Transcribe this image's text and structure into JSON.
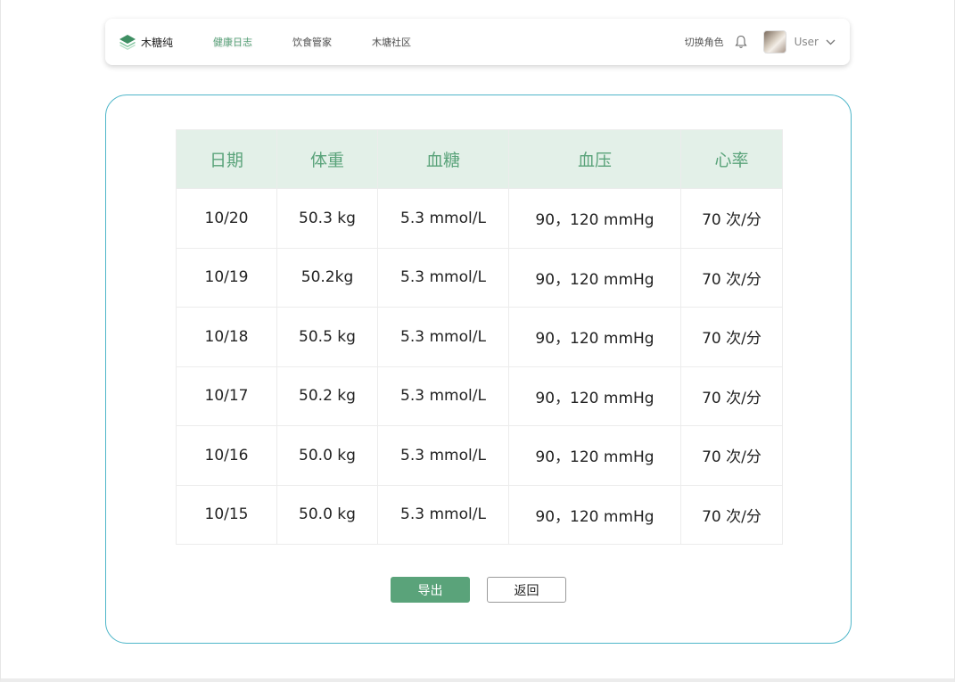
{
  "brand": {
    "name": "木糖纯",
    "logo_icon": "layers-logo-icon"
  },
  "nav": {
    "items": [
      {
        "label": "健康日志",
        "active": true
      },
      {
        "label": "饮食管家",
        "active": false
      },
      {
        "label": "木塘社区",
        "active": false
      }
    ],
    "switch_role": "切换角色",
    "user": "User"
  },
  "table": {
    "headers": [
      "日期",
      "体重",
      "血糖",
      "血压",
      "心率"
    ],
    "rows": [
      [
        "10/20",
        "50.3 kg",
        "5.3 mmol/L",
        "90，120 mmHg",
        "70 次/分"
      ],
      [
        "10/19",
        "50.2kg",
        "5.3 mmol/L",
        "90，120 mmHg",
        "70 次/分"
      ],
      [
        "10/18",
        "50.5 kg",
        "5.3 mmol/L",
        "90，120 mmHg",
        "70 次/分"
      ],
      [
        "10/17",
        "50.2 kg",
        "5.3 mmol/L",
        "90，120 mmHg",
        "70 次/分"
      ],
      [
        "10/16",
        "50.0 kg",
        "5.3 mmol/L",
        "90，120 mmHg",
        "70 次/分"
      ],
      [
        "10/15",
        "50.0 kg",
        "5.3 mmol/L",
        "90，120 mmHg",
        "70 次/分"
      ]
    ]
  },
  "actions": {
    "export_label": "导出",
    "back_label": "返回"
  },
  "colors": {
    "accent": "#5aa37a",
    "header_bg": "#e3f0e8",
    "card_border": "#4fb6c9"
  }
}
